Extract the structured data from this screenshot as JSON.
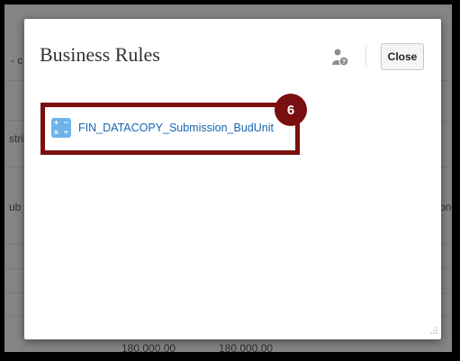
{
  "background": {
    "header_fragment": "- c",
    "row_fragment_1": "stri",
    "row_fragment_2": "ub",
    "row_fragment_3": "on",
    "value_1": "180,000.00",
    "value_2": "180,000.00"
  },
  "dialog": {
    "title": "Business Rules",
    "close_label": "Close",
    "rules": [
      {
        "name": "FIN_DATACOPY_Submission_BudUnit"
      }
    ]
  },
  "tutorial": {
    "step_number": "6",
    "highlight_color": "#7a0f0f"
  },
  "icons": [
    "user-help-icon",
    "calculator-icon",
    "resize-grip-icon"
  ],
  "colors": {
    "link": "#1766b1",
    "rule_icon": "#6fb3ea",
    "overlay": "rgba(40,40,40,0.55)"
  }
}
